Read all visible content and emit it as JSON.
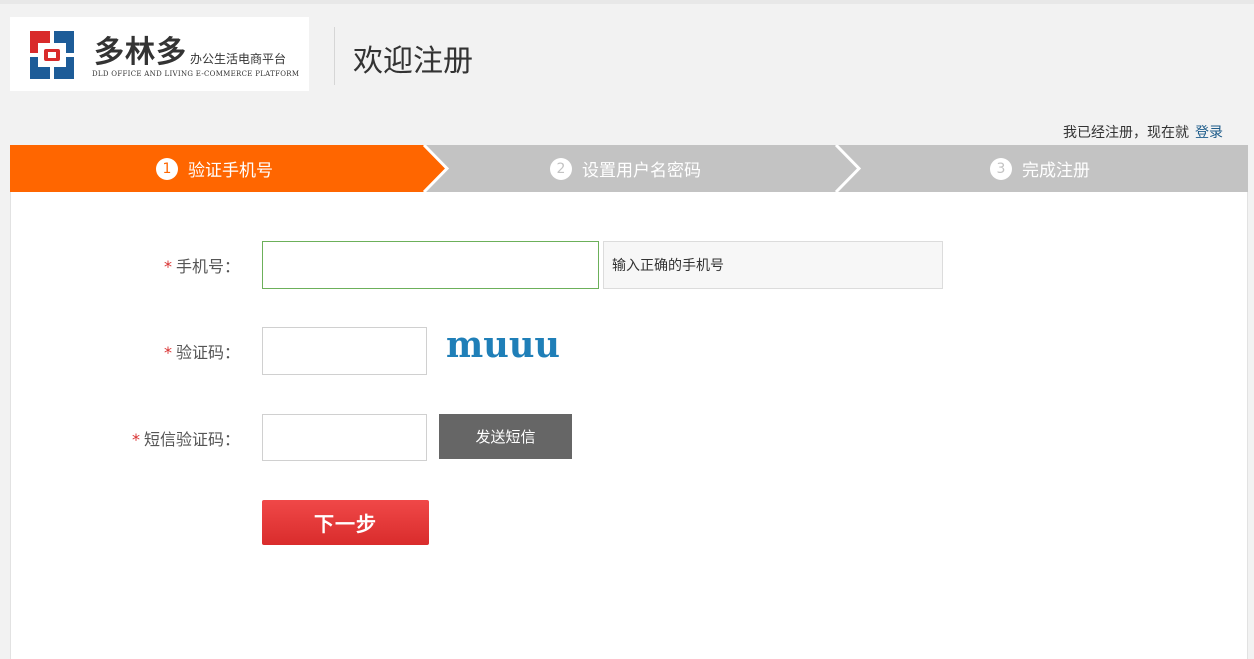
{
  "header": {
    "brand_name": "多林多",
    "brand_tagline": "办公生活电商平台",
    "brand_en": "DLD OFFICE AND LIVING E-COMMERCE PLATFORM",
    "page_title": "欢迎注册"
  },
  "login_hint": {
    "text": "我已经注册，现在就",
    "link": "登录"
  },
  "steps": [
    {
      "num": "1",
      "label": "验证手机号",
      "active": true
    },
    {
      "num": "2",
      "label": "设置用户名密码",
      "active": false
    },
    {
      "num": "3",
      "label": "完成注册",
      "active": false
    }
  ],
  "form": {
    "required_mark": "*",
    "phone": {
      "label": "手机号：",
      "value": "",
      "hint": "输入正确的手机号"
    },
    "captcha": {
      "label": "验证码：",
      "value": "",
      "image_text": "muuu"
    },
    "sms": {
      "label": "短信验证码：",
      "value": "",
      "button": "发送短信"
    },
    "next_button": "下一步"
  },
  "colors": {
    "accent_orange": "#ff6600",
    "step_inactive": "#c3c3c3",
    "next_red": "#e23a3a",
    "sms_button": "#666666",
    "captcha_blue": "#1f7fb8",
    "logo_red": "#d92b2b",
    "logo_blue": "#1d5c98"
  }
}
